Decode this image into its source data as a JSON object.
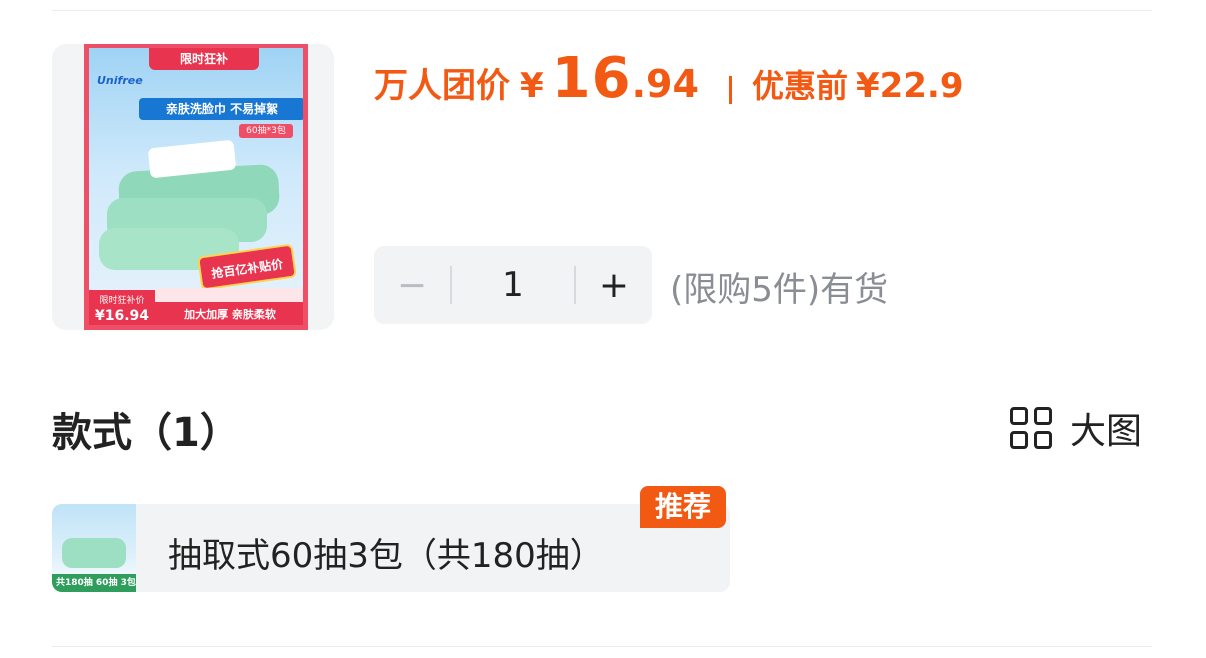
{
  "product": {
    "image": {
      "banner": "限时狂补",
      "brand": "Unifree",
      "headline": "亲肤洗脸巾 不易掉絮",
      "spec": "60抽*3包",
      "promo": "抢百亿补贴价",
      "tag_label": "限时狂补价",
      "tag_price": "¥16.94",
      "footer": "加大加厚 亲肤柔软"
    }
  },
  "price": {
    "label": "万人团价",
    "currency": "¥",
    "integer": "16",
    "decimal": ".94",
    "original_label": "优惠前",
    "original_price": "¥22.9",
    "color": "#f25a14"
  },
  "quantity": {
    "minus": "−",
    "value": "1",
    "plus": "+",
    "stock_note": "(限购5件)有货"
  },
  "styles": {
    "title": "款式（1）",
    "view_large_icon": "grid-icon",
    "view_large_label": "大图",
    "options": [
      {
        "label": "抽取式60抽3包（共180抽）",
        "badge": "推荐",
        "thumb_text": "共180抽 60抽 3包"
      }
    ]
  }
}
